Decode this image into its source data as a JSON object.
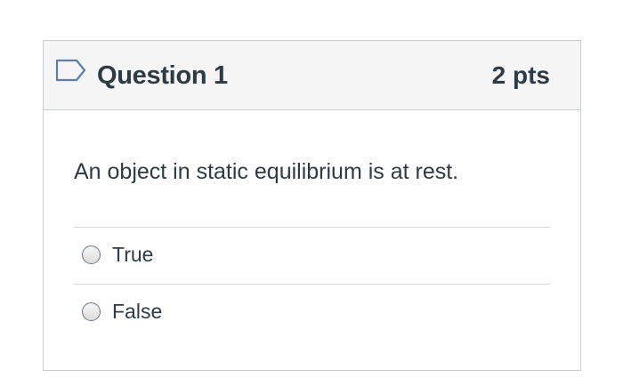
{
  "question": {
    "title": "Question 1",
    "points": "2 pts",
    "text": "An object in static equilibrium is at rest.",
    "flag_icon": "flag-outline-icon",
    "answers": [
      {
        "label": "True",
        "selected": false
      },
      {
        "label": "False",
        "selected": false
      }
    ]
  },
  "colors": {
    "text": "#2d3b45",
    "header_bg": "#f5f5f5",
    "border": "#c7cdd1",
    "flag": "#5c7fa6"
  }
}
